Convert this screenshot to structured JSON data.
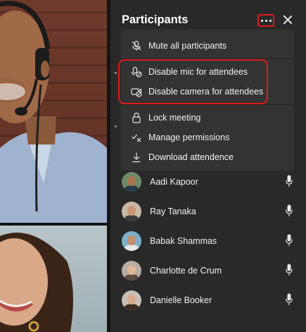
{
  "panel": {
    "title": "Participants",
    "more_icon": "more-horizontal-icon",
    "close_icon": "close-icon"
  },
  "menu": {
    "items": [
      {
        "label": "Mute all participants",
        "icon": "mic-off-icon"
      },
      {
        "label": "Disable mic for attendees",
        "icon": "mic-disable-icon"
      },
      {
        "label": "Disable camera for attendees",
        "icon": "camera-disable-icon"
      },
      {
        "label": "Lock meeting",
        "icon": "lock-icon"
      },
      {
        "label": "Manage permissions",
        "icon": "permissions-icon"
      },
      {
        "label": "Download attendence",
        "icon": "download-icon"
      }
    ]
  },
  "participants": [
    {
      "name": "Aadi Kapoor",
      "mic_icon": "mic-icon"
    },
    {
      "name": "Ray Tanaka",
      "mic_icon": "mic-icon"
    },
    {
      "name": "Babak Shammas",
      "mic_icon": "mic-icon"
    },
    {
      "name": "Charlotte de Crum",
      "mic_icon": "mic-icon"
    },
    {
      "name": "Danielle Booker",
      "mic_icon": "mic-icon"
    }
  ],
  "colors": {
    "highlight": "#e11a1a",
    "panel_bg": "#292929",
    "menu_bg": "#333333"
  }
}
